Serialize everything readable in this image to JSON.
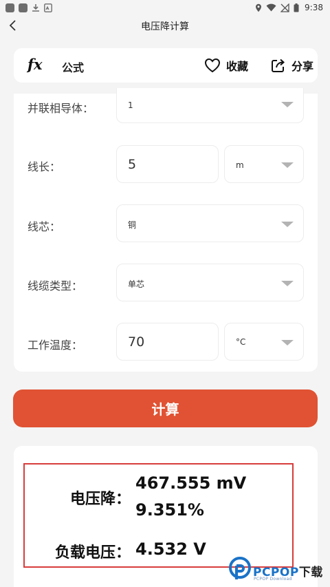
{
  "status_bar": {
    "time": "9:38"
  },
  "nav": {
    "title": "电压降计算"
  },
  "formula_card": {
    "fx": "fx",
    "label": "公式",
    "favorite_label": "收藏",
    "share_label": "分享"
  },
  "form": {
    "parallel": {
      "label": "并联相导体：",
      "value": "1"
    },
    "length": {
      "label": "线长：",
      "value": "5",
      "unit": "m"
    },
    "core": {
      "label": "线芯：",
      "value": "铜"
    },
    "cable_type": {
      "label": "线缆类型：",
      "value": "单芯"
    },
    "temperature": {
      "label": "工作温度：",
      "value": "70",
      "unit": "°C"
    }
  },
  "calculate_label": "计算",
  "result": {
    "drop_label": "电压降：",
    "drop_value": "467.555 mV",
    "drop_percent": "9.351%",
    "load_label": "负载电压：",
    "load_value": "4.532 V"
  },
  "watermark": {
    "brand": "PCPOP",
    "cn": "下载",
    "sub": "PCPOP Download"
  },
  "colors": {
    "accent": "#e05233",
    "frame": "#d83b3b",
    "watermark": "#1a73c8"
  }
}
